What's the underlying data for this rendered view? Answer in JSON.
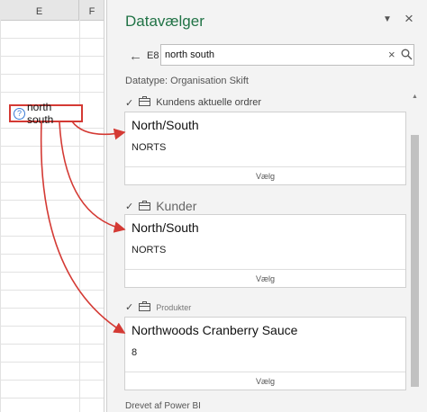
{
  "sheet": {
    "columns": [
      "E",
      "F"
    ],
    "active_cell_value": "north south"
  },
  "pane": {
    "title": "Datavælger",
    "cell_ref": "E8",
    "search_value": "north south",
    "datatype": "Datatype: Organisation Skift",
    "groups": [
      {
        "label": "Kundens aktuelle ordrer",
        "card_title": "North/South",
        "card_sub": "NORTS",
        "button": "Vælg"
      },
      {
        "label": "Kunder",
        "card_title": "North/South",
        "card_sub": "NORTS",
        "button": "Vælg"
      },
      {
        "label": "Produkter",
        "card_title": "Northwoods Cranberry Sauce",
        "card_sub": "8",
        "button": "Vælg"
      }
    ],
    "footer": "Drevet af Power BI"
  },
  "colors": {
    "accent": "#217346",
    "callout": "#d43a34"
  },
  "icons": [
    "back-arrow-icon",
    "search-icon",
    "close-icon",
    "chevron-down-icon",
    "briefcase-icon",
    "linked-data-icon"
  ]
}
